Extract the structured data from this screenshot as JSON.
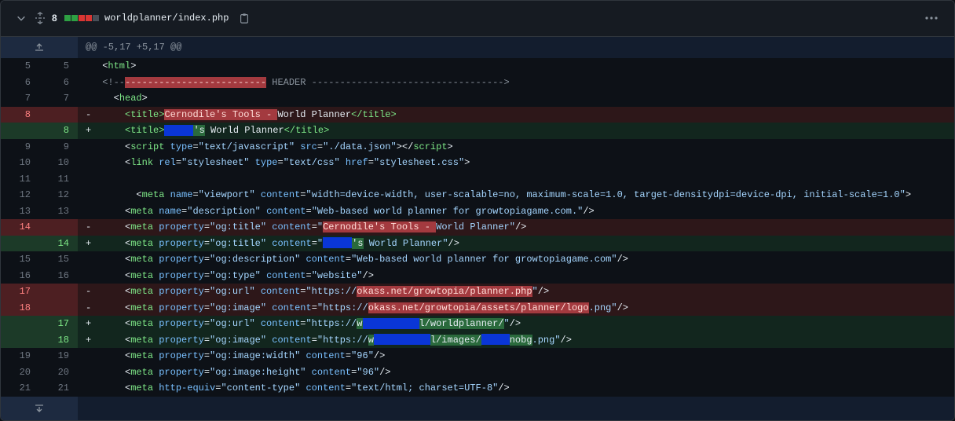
{
  "file": {
    "change_count": "8",
    "name": "worldplanner/index.php",
    "stat_colors": [
      "#2ea043",
      "#2ea043",
      "#da3633",
      "#da3633",
      "#484f58"
    ]
  },
  "icons": {
    "collapse": "chevron-down-icon",
    "expand_all": "unfold-icon",
    "copy": "copy-icon",
    "more": "kebab-horizontal-icon",
    "expand_up": "expand-up-icon",
    "expand_down": "expand-down-icon"
  },
  "hunk_header": "@@ -5,17 +5,17 @@",
  "colors": {
    "added": "#2ea043",
    "deleted": "#da3633",
    "redaction": "#0a36d6"
  },
  "lines": [
    {
      "type": "ctx",
      "old": "5",
      "new": "5"
    },
    {
      "type": "ctx",
      "old": "6",
      "new": "6"
    },
    {
      "type": "ctx",
      "old": "7",
      "new": "7"
    },
    {
      "type": "del",
      "old": "8",
      "new": ""
    },
    {
      "type": "add",
      "old": "",
      "new": "8"
    },
    {
      "type": "ctx",
      "old": "9",
      "new": "9"
    },
    {
      "type": "ctx",
      "old": "10",
      "new": "10"
    },
    {
      "type": "ctx",
      "old": "11",
      "new": "11"
    },
    {
      "type": "ctx",
      "old": "12",
      "new": "12"
    },
    {
      "type": "ctx",
      "old": "13",
      "new": "13"
    },
    {
      "type": "del",
      "old": "14",
      "new": ""
    },
    {
      "type": "add",
      "old": "",
      "new": "14"
    },
    {
      "type": "ctx",
      "old": "15",
      "new": "15"
    },
    {
      "type": "ctx",
      "old": "16",
      "new": "16"
    },
    {
      "type": "del",
      "old": "17",
      "new": ""
    },
    {
      "type": "del",
      "old": "18",
      "new": ""
    },
    {
      "type": "add",
      "old": "",
      "new": "17"
    },
    {
      "type": "add",
      "old": "",
      "new": "18"
    },
    {
      "type": "ctx",
      "old": "19",
      "new": "19"
    },
    {
      "type": "ctx",
      "old": "20",
      "new": "20"
    },
    {
      "type": "ctx",
      "old": "21",
      "new": "21"
    }
  ],
  "code": {
    "l5": [
      "<",
      "html",
      ">"
    ],
    "l6_prefix": "<!--",
    "l6_dashes": "-------------------------",
    "l6_rest": " HEADER ---------------------------------->",
    "l7": [
      "<",
      "head",
      ">"
    ],
    "l8_del_hl": "Cernodile's Tools - ",
    "l8_rest": "World Planner",
    "l8_add_after": "'s",
    "l8_add_rest": " World Planner",
    "title_open": "<title>",
    "title_close": "</title>",
    "l9_script": "script",
    "l9_type": "type",
    "l9_type_val": "\"text/javascript\"",
    "l9_src": "src",
    "l9_src_val": "\"./data.json\"",
    "l10_link": "link",
    "l10_rel": "rel",
    "l10_rel_val": "\"stylesheet\"",
    "l10_type_val": "\"text/css\"",
    "l10_href": "href",
    "l10_href_val": "\"stylesheet.css\"",
    "meta": "meta",
    "name": "name",
    "content": "content",
    "property": "property",
    "l12_name_val": "\"viewport\"",
    "l12_content_val": "\"width=device-width, user-scalable=no, maximum-scale=1.0, target-densitydpi=device-dpi, initial-scale=1.0\"",
    "l13_name_val": "\"description\"",
    "l13_content_val": "\"Web-based world planner for growtopiagame.com.\"",
    "og_title": "\"og:title\"",
    "l14_del_hl": "Cernodile's Tools - ",
    "l14_rest": "World Planner\"",
    "l14_add_after": "'s",
    "l14_add_rest": " World Planner\"",
    "og_description": "\"og:description\"",
    "l15_content_val": "\"Web-based world planner for growtopiagame.com\"",
    "og_type": "\"og:type\"",
    "l16_content_val": "\"website\"",
    "og_url": "\"og:url\"",
    "og_image": "\"og:image\"",
    "https": "\"https://",
    "l17_del_hl": "okass.net/growtopia/planner.php",
    "l18_del_hl1": "okass.net/growtopia/assets/planner/logo",
    "l18_del_rest": ".png\"",
    "l17_add_mid": "l/worldplanner/",
    "l17_add_tail": "\"",
    "l18_add_mid1": "l/images/",
    "l18_add_mid2": "nobg",
    "l18_add_tail": ".png\"",
    "og_image_width": "\"og:image:width\"",
    "og_image_height": "\"og:image:height\"",
    "val_96": "\"96\"",
    "http_equiv": "http-equiv",
    "l21_equiv_val": "\"content-type\"",
    "l21_content_val": "\"text/html; charset=UTF-8\"",
    "self_close": "/>",
    "close": ">",
    "close_script": "></",
    "eq": "=",
    "lt": "<",
    "w_letter": "w"
  }
}
